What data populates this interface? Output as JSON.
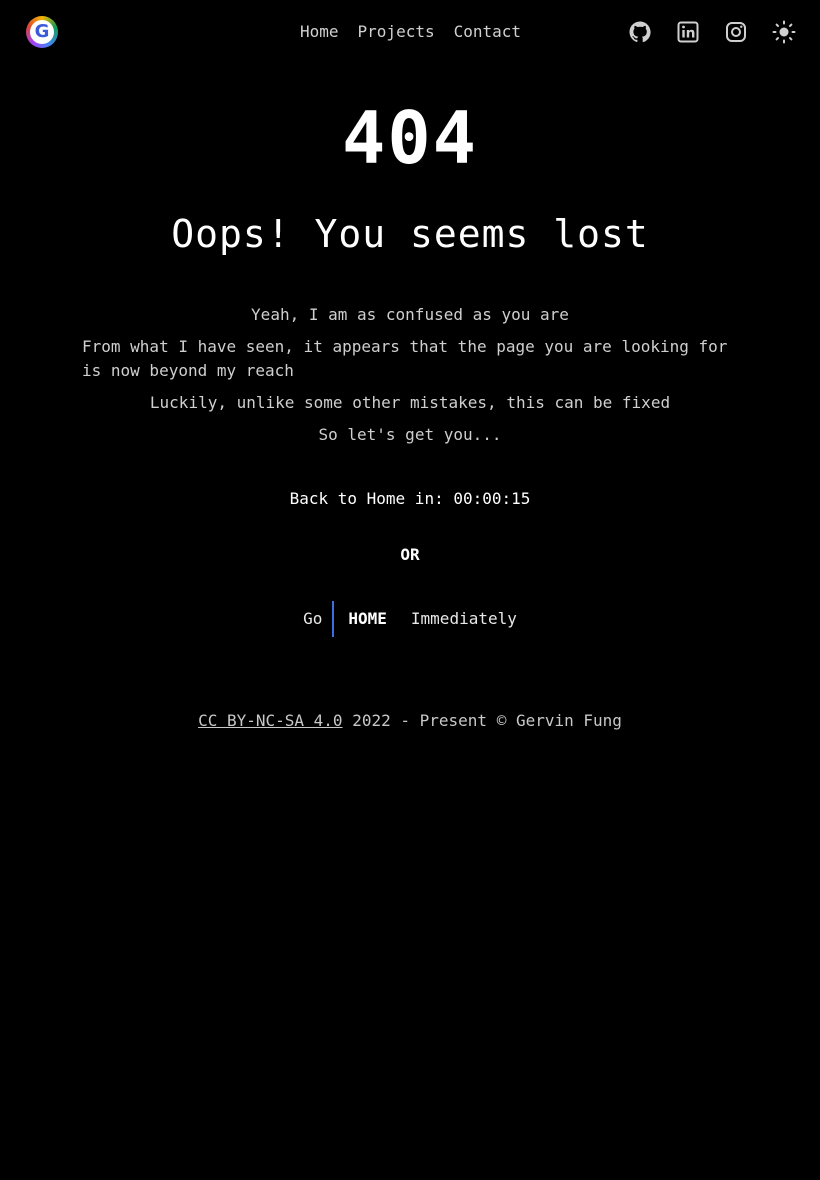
{
  "header": {
    "logo_letter": "G",
    "nav": [
      {
        "label": "Home"
      },
      {
        "label": "Projects"
      },
      {
        "label": "Contact"
      }
    ],
    "icons": [
      "github-icon",
      "linkedin-icon",
      "instagram-icon",
      "sun-icon"
    ]
  },
  "main": {
    "code": "404",
    "title": "Oops! You seems lost",
    "paragraphs": [
      "Yeah, I am as confused as you are",
      "From what I have seen, it appears that the page you are looking for is now beyond my reach",
      "Luckily, unlike some other mistakes, this can be fixed",
      "So let's get you..."
    ],
    "countdown_label": "Back to Home in:",
    "countdown_value": "00:00:15",
    "or_label": "OR",
    "go_label": "Go",
    "home_link_label": "HOME",
    "immediately_label": "Immediately"
  },
  "footer": {
    "license_link": "CC BY-NC-SA 4.0",
    "text": "2022 - Present © Gervin Fung"
  },
  "colors": {
    "background": "#000000",
    "accent": "#3b6fe0",
    "text": "#ffffff"
  }
}
